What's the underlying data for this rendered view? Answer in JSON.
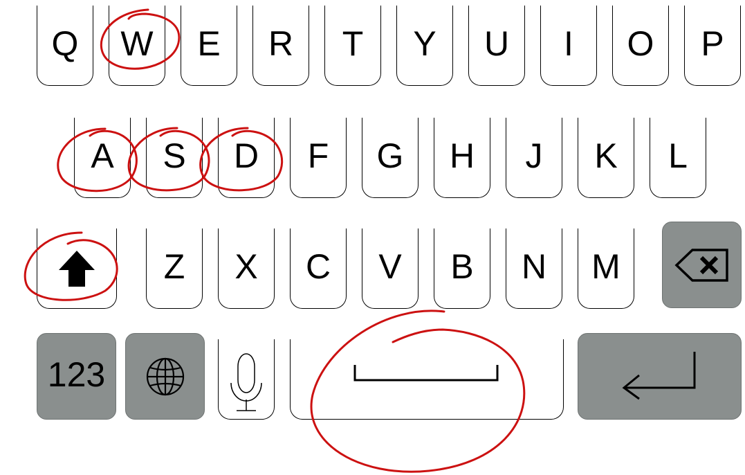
{
  "keyboard": {
    "row1": [
      "Q",
      "W",
      "E",
      "R",
      "T",
      "Y",
      "U",
      "I",
      "O",
      "P"
    ],
    "row2": [
      "A",
      "S",
      "D",
      "F",
      "G",
      "H",
      "J",
      "K",
      "L"
    ],
    "row3": [
      "Z",
      "X",
      "C",
      "V",
      "B",
      "N",
      "M"
    ],
    "numbers_label": "123"
  },
  "keys_icons": {
    "shift": "shift-arrow-icon",
    "backspace": "backspace-icon",
    "globe": "globe-icon",
    "mic": "microphone-icon",
    "space": "space-bracket-icon",
    "return": "return-arrow-icon"
  },
  "colors": {
    "function_key": "#8a8f8e",
    "annotation": "#cc1111",
    "key_border": "#000000"
  }
}
